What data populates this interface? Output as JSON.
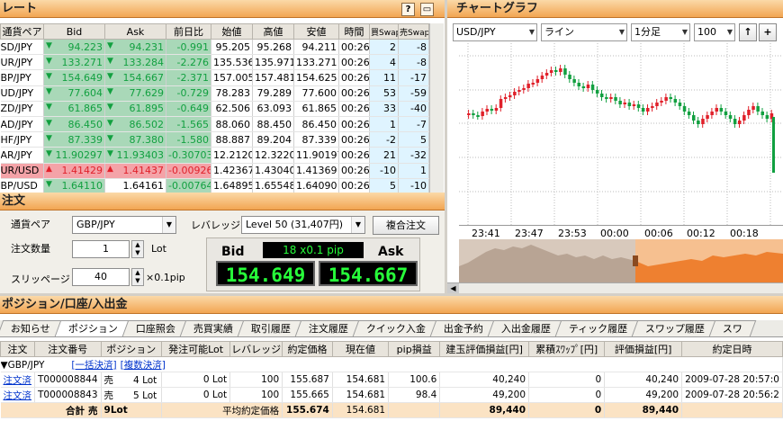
{
  "rate_panel": {
    "title": "レート",
    "help_label": "?",
    "columns": [
      "通貨ペア",
      "Bid",
      "Ask",
      "前日比",
      "始値",
      "高値",
      "安値",
      "時間",
      "買Swap",
      "売Swap"
    ],
    "rows": [
      {
        "pair": "SD/JPY",
        "bid_dir": "down",
        "bid": "94.223",
        "ask_dir": "down",
        "ask": "94.231",
        "change": "-0.991",
        "open": "95.205",
        "high": "95.268",
        "low": "94.211",
        "time": "00:26",
        "buy_swap": "2",
        "sell_swap": "-8"
      },
      {
        "pair": "UR/JPY",
        "bid_dir": "down",
        "bid": "133.271",
        "ask_dir": "down",
        "ask": "133.284",
        "change": "-2.276",
        "open": "135.536",
        "high": "135.971",
        "low": "133.271",
        "time": "00:26",
        "buy_swap": "4",
        "sell_swap": "-8"
      },
      {
        "pair": "BP/JPY",
        "bid_dir": "down",
        "bid": "154.649",
        "ask_dir": "down",
        "ask": "154.667",
        "change": "-2.371",
        "open": "157.005",
        "high": "157.481",
        "low": "154.625",
        "time": "00:26",
        "buy_swap": "11",
        "sell_swap": "-17"
      },
      {
        "pair": "UD/JPY",
        "bid_dir": "down",
        "bid": "77.604",
        "ask_dir": "down",
        "ask": "77.629",
        "change": "-0.729",
        "open": "78.283",
        "high": "79.289",
        "low": "77.600",
        "time": "00:26",
        "buy_swap": "53",
        "sell_swap": "-59"
      },
      {
        "pair": "ZD/JPY",
        "bid_dir": "down",
        "bid": "61.865",
        "ask_dir": "down",
        "ask": "61.895",
        "change": "-0.649",
        "open": "62.506",
        "high": "63.093",
        "low": "61.865",
        "time": "00:26",
        "buy_swap": "33",
        "sell_swap": "-40"
      },
      {
        "pair": "AD/JPY",
        "bid_dir": "down",
        "bid": "86.450",
        "ask_dir": "down",
        "ask": "86.502",
        "change": "-1.565",
        "open": "88.060",
        "high": "88.450",
        "low": "86.450",
        "time": "00:26",
        "buy_swap": "1",
        "sell_swap": "-7"
      },
      {
        "pair": "HF/JPY",
        "bid_dir": "down",
        "bid": "87.339",
        "ask_dir": "down",
        "ask": "87.380",
        "change": "-1.580",
        "open": "88.887",
        "high": "89.204",
        "low": "87.339",
        "time": "00:26",
        "buy_swap": "-2",
        "sell_swap": "5"
      },
      {
        "pair": "AR/JPY",
        "bid_dir": "down",
        "bid": "11.90297",
        "ask_dir": "down",
        "ask": "11.93403",
        "change": "-0.30703",
        "open": "12.21200",
        "high": "12.32200",
        "low": "11.90197",
        "time": "00:26",
        "buy_swap": "21",
        "sell_swap": "-32"
      },
      {
        "pair": "UR/USD",
        "bid_dir": "up",
        "bid": "1.41429",
        "ask_dir": "up",
        "ask": "1.41437",
        "change": "-0.00926",
        "open": "1.42367",
        "high": "1.43040",
        "low": "1.41369",
        "time": "00:26",
        "buy_swap": "-10",
        "sell_swap": "1"
      },
      {
        "pair": "BP/USD",
        "bid_dir": "down",
        "bid": "1.64110",
        "ask_dir": "none",
        "ask": "1.64161",
        "change": "-0.00764",
        "open": "1.64895",
        "high": "1.65548",
        "low": "1.64090",
        "time": "00:26",
        "buy_swap": "5",
        "sell_swap": "-10"
      }
    ]
  },
  "chart_panel": {
    "title": "チャートグラフ",
    "pair_select": "USD/JPY",
    "type_select": "ライン",
    "period_select": "1分足",
    "count_select": "100",
    "up_icon": "arrow-up-icon",
    "plus_label": "+",
    "time_ticks": [
      "23:41",
      "23:47",
      "23:53",
      "00:00",
      "00:06",
      "00:12",
      "00:18"
    ]
  },
  "order_panel": {
    "title": "注文",
    "pair_label": "通貨ペア",
    "pair_value": "GBP/JPY",
    "leverage_label": "レバレッジ",
    "leverage_value": "Level 50 (31,407円)",
    "compound_button": "複合注文",
    "qty_label": "注文数量",
    "qty_value": "1",
    "qty_unit": "Lot",
    "slip_label": "スリッページ",
    "slip_value": "40",
    "slip_unit": "×0.1pip",
    "bid_label": "Bid",
    "ask_label": "Ask",
    "spread": "18 x0.1 pip",
    "bid_price": "154.649",
    "ask_price": "154.667"
  },
  "position_panel": {
    "title": "ポジション/口座/入出金",
    "tabs": [
      "お知らせ",
      "ポジション",
      "口座照会",
      "売買実績",
      "取引履歴",
      "注文履歴",
      "クイック入金",
      "出金予約",
      "入出金履歴",
      "ティック履歴",
      "スワップ履歴",
      "スワ"
    ],
    "active_tab": 1,
    "columns": [
      "注文",
      "注文番号",
      "ポジション",
      "発注可能Lot",
      "レバレッジ",
      "約定価格",
      "現在値",
      "pip損益",
      "建玉評価損益[円]",
      "累積ｽﾜｯﾌﾟ[円]",
      "評価損益[円]",
      "約定日時"
    ],
    "group_label": "▼GBP/JPY",
    "bulk_settle": "[一括決済]",
    "multi_settle": "[複数決済]",
    "rows": [
      {
        "action": "注文済",
        "order_no": "T000008844",
        "side": "売",
        "lots": "4 Lot",
        "avail": "0  Lot",
        "lev": "100",
        "price": "155.687",
        "current": "154.681",
        "pips": "100.6",
        "valuation": "40,240",
        "swap": "0",
        "pl": "40,240",
        "datetime": "2009-07-28 20:57:0"
      },
      {
        "action": "注文済",
        "order_no": "T000008843",
        "side": "売",
        "lots": "5 Lot",
        "avail": "0  Lot",
        "lev": "100",
        "price": "155.665",
        "current": "154.681",
        "pips": "98.4",
        "valuation": "49,200",
        "swap": "0",
        "pl": "49,200",
        "datetime": "2009-07-28 20:56:2"
      }
    ],
    "total": {
      "label": "合計",
      "side": "売",
      "lots": "9Lot",
      "avg_label": "平均約定価格",
      "avg_price": "155.674",
      "current": "154.681",
      "valuation": "89,440",
      "swap": "0",
      "pl": "89,440"
    }
  },
  "colors": {
    "bid_bg": "#a9d8b8",
    "down_green": "#12a040",
    "up_red": "#e0202a",
    "up_row_bg": "#f4a3a8",
    "header_orange": "#f2a552",
    "price_display": "#27ff3a"
  }
}
